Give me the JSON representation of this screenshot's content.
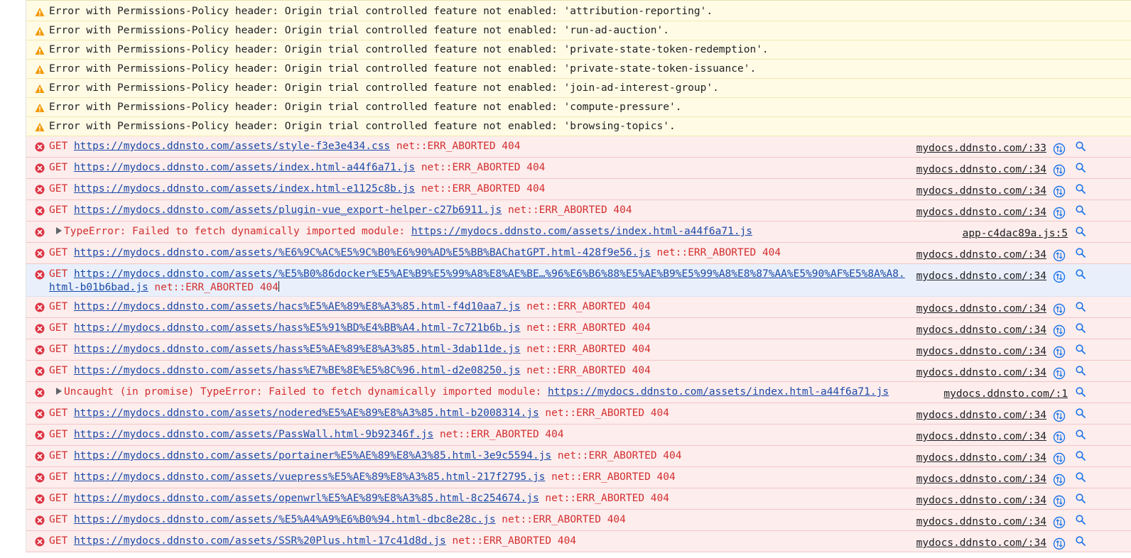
{
  "warnings": [
    {
      "text": "Error with Permissions-Policy header: Origin trial controlled feature not enabled: 'attribution-reporting'."
    },
    {
      "text": "Error with Permissions-Policy header: Origin trial controlled feature not enabled: 'run-ad-auction'."
    },
    {
      "text": "Error with Permissions-Policy header: Origin trial controlled feature not enabled: 'private-state-token-redemption'."
    },
    {
      "text": "Error with Permissions-Policy header: Origin trial controlled feature not enabled: 'private-state-token-issuance'."
    },
    {
      "text": "Error with Permissions-Policy header: Origin trial controlled feature not enabled: 'join-ad-interest-group'."
    },
    {
      "text": "Error with Permissions-Policy header: Origin trial controlled feature not enabled: 'compute-pressure'."
    },
    {
      "text": "Error with Permissions-Policy header: Origin trial controlled feature not enabled: 'browsing-topics'."
    }
  ],
  "errors": [
    {
      "kind": "get",
      "method": "GET",
      "url": "https://mydocs.ddnsto.com/assets/style-f3e3e434.css",
      "suffix": "net::ERR_ABORTED 404",
      "source": "mydocs.ddnsto.com/:33"
    },
    {
      "kind": "get",
      "method": "GET",
      "url": "https://mydocs.ddnsto.com/assets/index.html-a44f6a71.js",
      "suffix": "net::ERR_ABORTED 404",
      "source": "mydocs.ddnsto.com/:34"
    },
    {
      "kind": "get",
      "method": "GET",
      "url": "https://mydocs.ddnsto.com/assets/index.html-e1125c8b.js",
      "suffix": "net::ERR_ABORTED 404",
      "source": "mydocs.ddnsto.com/:34"
    },
    {
      "kind": "get",
      "method": "GET",
      "url": "https://mydocs.ddnsto.com/assets/plugin-vue_export-helper-c27b6911.js",
      "suffix": "net::ERR_ABORTED 404",
      "source": "mydocs.ddnsto.com/:34"
    },
    {
      "kind": "exception",
      "prefix": "TypeError: Failed to fetch dynamically imported module:",
      "url": "https://mydocs.ddnsto.com/assets/index.html-a44f6a71.js",
      "source": "app-c4dac89a.js:5"
    },
    {
      "kind": "get",
      "method": "GET",
      "url": "https://mydocs.ddnsto.com/assets/%E6%9C%AC%E5%9C%B0%E6%90%AD%E5%BB%BAChatGPT.html-428f9e56.js",
      "suffix": "net::ERR_ABORTED 404",
      "source": "mydocs.ddnsto.com/:34"
    },
    {
      "kind": "get",
      "tall": true,
      "method": "GET",
      "url": "https://mydocs.ddnsto.com/assets/%E5%B0%86docker%E5%AE%B9%E5%99%A8%E8%AE%BE…%96%E6%B6%88%E5%AE%B9%E5%99%A8%E8%87%AA%E5%90%AF%E5%8A%A8.html-b01b6bad.js",
      "suffix": "net::ERR_ABORTED 404",
      "source": "mydocs.ddnsto.com/:34"
    },
    {
      "kind": "get",
      "method": "GET",
      "url": "https://mydocs.ddnsto.com/assets/hacs%E5%AE%89%E8%A3%85.html-f4d10aa7.js",
      "suffix": "net::ERR_ABORTED 404",
      "source": "mydocs.ddnsto.com/:34"
    },
    {
      "kind": "get",
      "method": "GET",
      "url": "https://mydocs.ddnsto.com/assets/hass%E5%91%BD%E4%BB%A4.html-7c721b6b.js",
      "suffix": "net::ERR_ABORTED 404",
      "source": "mydocs.ddnsto.com/:34"
    },
    {
      "kind": "get",
      "method": "GET",
      "url": "https://mydocs.ddnsto.com/assets/hass%E5%AE%89%E8%A3%85.html-3dab11de.js",
      "suffix": "net::ERR_ABORTED 404",
      "source": "mydocs.ddnsto.com/:34"
    },
    {
      "kind": "get",
      "method": "GET",
      "url": "https://mydocs.ddnsto.com/assets/hass%E7%BE%8E%E5%8C%96.html-d2e08250.js",
      "suffix": "net::ERR_ABORTED 404",
      "source": "mydocs.ddnsto.com/:34"
    },
    {
      "kind": "exception",
      "prefix": "Uncaught (in promise) TypeError: Failed to fetch dynamically imported module:",
      "url": "https://mydocs.ddnsto.com/assets/index.html-a44f6a71.js",
      "source": "mydocs.ddnsto.com/:1"
    },
    {
      "kind": "get",
      "method": "GET",
      "url": "https://mydocs.ddnsto.com/assets/nodered%E5%AE%89%E8%A3%85.html-b2008314.js",
      "suffix": "net::ERR_ABORTED 404",
      "source": "mydocs.ddnsto.com/:34"
    },
    {
      "kind": "get",
      "method": "GET",
      "url": "https://mydocs.ddnsto.com/assets/PassWall.html-9b92346f.js",
      "suffix": "net::ERR_ABORTED 404",
      "source": "mydocs.ddnsto.com/:34"
    },
    {
      "kind": "get",
      "method": "GET",
      "url": "https://mydocs.ddnsto.com/assets/portainer%E5%AE%89%E8%A3%85.html-3e9c5594.js",
      "suffix": "net::ERR_ABORTED 404",
      "source": "mydocs.ddnsto.com/:34"
    },
    {
      "kind": "get",
      "method": "GET",
      "url": "https://mydocs.ddnsto.com/assets/vuepress%E5%AE%89%E8%A3%85.html-217f2795.js",
      "suffix": "net::ERR_ABORTED 404",
      "source": "mydocs.ddnsto.com/:34"
    },
    {
      "kind": "get",
      "method": "GET",
      "url": "https://mydocs.ddnsto.com/assets/openwrl%E5%AE%89%E8%A3%85.html-8c254674.js",
      "suffix": "net::ERR_ABORTED 404",
      "source": "mydocs.ddnsto.com/:34"
    },
    {
      "kind": "get",
      "method": "GET",
      "url": "https://mydocs.ddnsto.com/assets/%E5%A4%A9%E6%B0%94.html-dbc8e28c.js",
      "suffix": "net::ERR_ABORTED 404",
      "source": "mydocs.ddnsto.com/:34"
    },
    {
      "kind": "get",
      "method": "GET",
      "url": "https://mydocs.ddnsto.com/assets/SSR%20Plus.html-17c41d8d.js",
      "suffix": "net::ERR_ABORTED 404",
      "source": "mydocs.ddnsto.com/:34"
    }
  ],
  "colors": {
    "warning_bg": "#fffbe5",
    "error_bg": "#fdeded",
    "error_text": "#d32f2f",
    "link": "#1a4aa8",
    "warning_icon": "#f29900",
    "error_icon": "#dc3545"
  }
}
